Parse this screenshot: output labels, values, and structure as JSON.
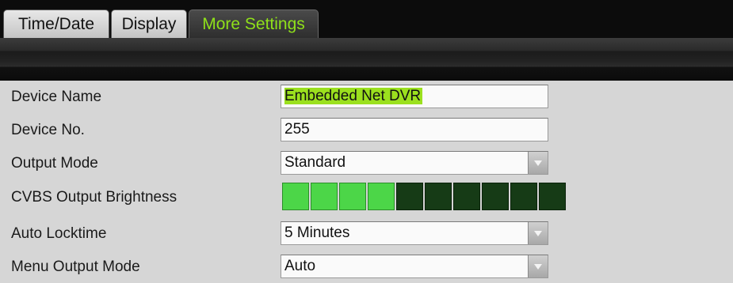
{
  "tabs": [
    {
      "label": "Time/Date",
      "active": false
    },
    {
      "label": "Display",
      "active": false
    },
    {
      "label": "More Settings",
      "active": true
    }
  ],
  "colors": {
    "active_tab_text": "#8fe01a",
    "highlight": "#9be01e",
    "brightness_on": "#4cd648",
    "brightness_off": "#163b16"
  },
  "settings": {
    "device_name": {
      "label": "Device Name",
      "value": "Embedded Net DVR"
    },
    "device_no": {
      "label": "Device No.",
      "value": "255"
    },
    "output_mode": {
      "label": "Output Mode",
      "value": "Standard"
    },
    "cvbs_brightness": {
      "label": "CVBS Output Brightness",
      "level": 4,
      "max": 10
    },
    "auto_locktime": {
      "label": "Auto Locktime",
      "value": "5 Minutes"
    },
    "menu_output_mode": {
      "label": "Menu Output Mode",
      "value": "Auto"
    }
  }
}
